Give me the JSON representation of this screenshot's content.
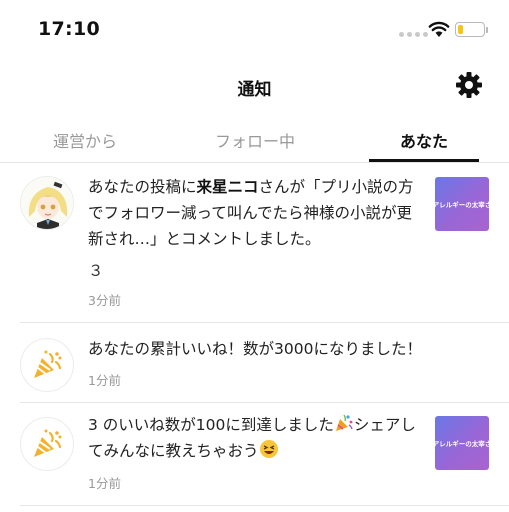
{
  "status_bar": {
    "time": "17:10",
    "battery_level": 0.2,
    "battery_color": "#f5c518"
  },
  "header": {
    "title": "通知",
    "settings_icon": "gear-icon"
  },
  "tabs": [
    {
      "label": "運営から",
      "active": false
    },
    {
      "label": "フォロー中",
      "active": false
    },
    {
      "label": "あなた",
      "active": true
    }
  ],
  "notifications": [
    {
      "icon": "user-avatar",
      "text_prefix": "あなたの投稿に",
      "user_name": "来星ニコ",
      "text_suffix": "さんが「プリ小説の方でフォロワー減って叫んでたら神様の小説が更新され…」とコメントしました。",
      "comment": "３",
      "time": "3分前",
      "thumbnail_text": "アレルギーの太宰さ"
    },
    {
      "icon": "party-popper-icon",
      "text": "あなたの累計いいね！数が3000になりました！",
      "time": "1分前"
    },
    {
      "icon": "party-popper-icon",
      "text_part1": "3 のいいね数が100に到達しました",
      "text_part2": "シェアしてみんなに教えちゃおう",
      "time": "1分前",
      "thumbnail_text": "アレルギーの太宰さ"
    }
  ]
}
